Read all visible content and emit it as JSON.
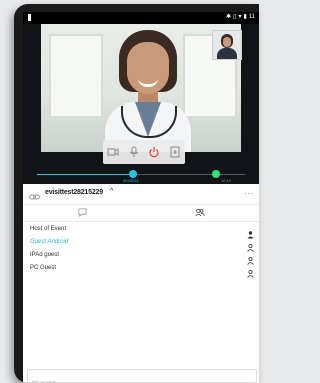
{
  "status_bar": {
    "icons": [
      "bluetooth-icon",
      "vibrate-icon",
      "wifi-icon",
      "battery-icon"
    ],
    "time": "11"
  },
  "video": {
    "controls": [
      {
        "name": "camera-icon"
      },
      {
        "name": "microphone-icon"
      },
      {
        "name": "power-icon",
        "color": "#e0443a"
      },
      {
        "name": "share-icon"
      }
    ],
    "current_time": "00:03:01",
    "total_time": "10:10",
    "progress_fraction": 0.46
  },
  "room": {
    "name": "evisittest28215229",
    "caret": "^",
    "more": "..."
  },
  "tabs": [
    {
      "name": "chat-icon"
    },
    {
      "name": "people-icon"
    }
  ],
  "participants": [
    {
      "name": "Host of Event",
      "italic": false,
      "icon": "host-person-icon"
    },
    {
      "name": "Guest Android",
      "italic": true,
      "icon": "person-icon"
    },
    {
      "name": "IPAd guest",
      "italic": false,
      "icon": "person-icon"
    },
    {
      "name": "PC Guest",
      "italic": false,
      "icon": "person-icon"
    }
  ],
  "filter": {
    "placeholder": "filter by name"
  },
  "colors": {
    "accent": "#1fc8e0",
    "end_marker": "#2ee27a",
    "guest_highlight": "#2bbdc9",
    "hangup": "#e0443a"
  }
}
